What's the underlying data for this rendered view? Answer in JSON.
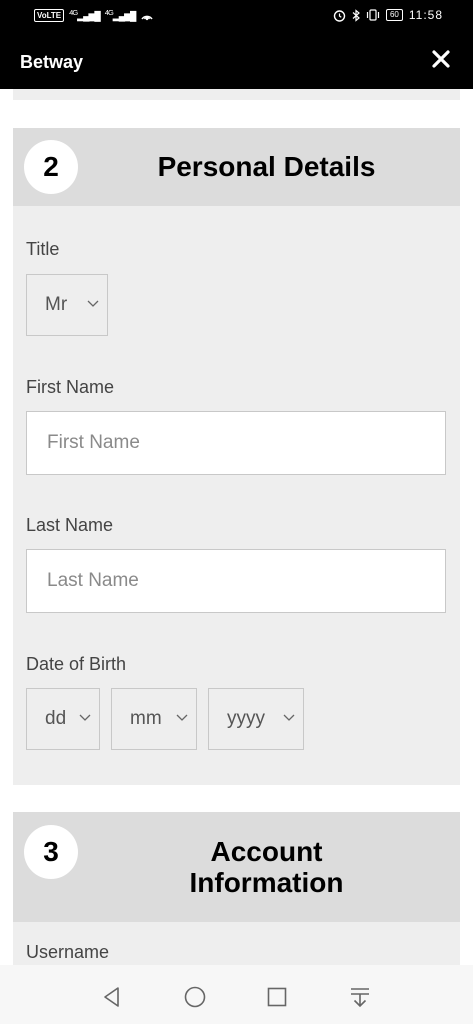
{
  "status_bar": {
    "volte": "VoLTE",
    "signal_1": "4G",
    "signal_2": "4G",
    "battery": "60",
    "time": "11:58"
  },
  "header": {
    "title": "Betway",
    "close_icon": "close-icon"
  },
  "personal": {
    "step": "2",
    "heading": "Personal Details",
    "title_label": "Title",
    "title_value": "Mr",
    "first_name_label": "First Name",
    "first_name_placeholder": "First Name",
    "last_name_label": "Last Name",
    "last_name_placeholder": "Last Name",
    "dob_label": "Date of Birth",
    "dob_day": "dd",
    "dob_month": "mm",
    "dob_year": "yyyy"
  },
  "account": {
    "step": "3",
    "heading_line1": "Account",
    "heading_line2": "Information",
    "username_label": "Username"
  },
  "nav_bar": {
    "icons": [
      "back-icon",
      "home-icon",
      "recents-icon",
      "notification-pull-icon"
    ]
  },
  "colors": {
    "header_bg": "#000000",
    "card_bg": "#eeeeee",
    "card_header_bg": "#dcdcdc"
  }
}
